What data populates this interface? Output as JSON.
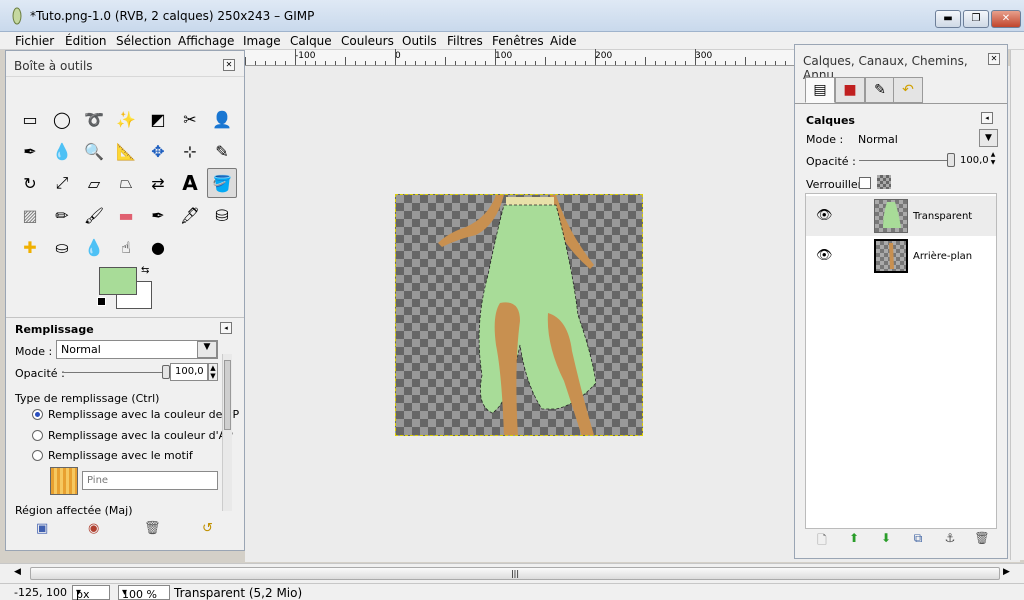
{
  "window": {
    "title": "*Tuto.png-1.0 (RVB, 2 calques) 250x243 – GIMP",
    "minimize": "▬",
    "maximize": "❐",
    "close": "✕"
  },
  "menu": [
    "Fichier",
    "Édition",
    "Sélection",
    "Affichage",
    "Image",
    "Calque",
    "Couleurs",
    "Outils",
    "Filtres",
    "Fenêtres",
    "Aide"
  ],
  "ruler": {
    "labels": [
      "-100",
      "0",
      "100",
      "200",
      "300"
    ]
  },
  "toolbox": {
    "title": "Boîte à outils",
    "fg_color": "#a8dc98",
    "bg_color": "#ffffff",
    "tools": [
      "rect-select-icon",
      "ellipse-select-icon",
      "lasso-icon",
      "magic-wand-icon",
      "select-by-color-icon",
      "scissors-icon",
      "foreground-select-icon",
      "paths-icon",
      "color-picker-icon",
      "zoom-icon",
      "measure-icon",
      "move-icon",
      "align-icon",
      "crop-icon",
      "rotate-icon",
      "scale-icon",
      "shear-icon",
      "perspective-icon",
      "flip-icon",
      "text-icon",
      "bucket-fill-icon",
      "blend-icon",
      "pencil-icon",
      "paintbrush-icon",
      "eraser-icon",
      "airbrush-icon",
      "ink-icon",
      "clone-icon",
      "heal-icon",
      "perspective-clone-icon",
      "blur-icon",
      "smudge-icon",
      "dodge-burn-icon"
    ]
  },
  "fill": {
    "title": "Remplissage",
    "mode_label": "Mode :",
    "mode_value": "Normal",
    "opacity_label": "Opacité :",
    "opacity_value": "100,0",
    "opacity_fraction": 1.0,
    "type_label": "Type de remplissage  (Ctrl)",
    "options": [
      "Remplissage avec la couleur de PP",
      "Remplissage avec la couleur d'AP",
      "Remplissage avec le motif"
    ],
    "selected_option": 0,
    "pattern_name": "Pine",
    "region_label": "Région affectée  (Maj)"
  },
  "layers": {
    "dock_title": "Calques, Canaux, Chemins, Annu...",
    "section_title": "Calques",
    "mode_label": "Mode :",
    "mode_value": "Normal",
    "opacity_label": "Opacité :",
    "opacity_value": "100,0",
    "opacity_fraction": 1.0,
    "lock_label": "Verrouiller :",
    "items": [
      {
        "name": "Transparent",
        "selected": true
      },
      {
        "name": "Arrière-plan",
        "selected": false
      }
    ]
  },
  "status": {
    "coords": "-125, 100",
    "unit": "px",
    "zoom": "100 %",
    "message": "Transparent (5,2 Mio)"
  },
  "colors": {
    "skirt": "#a8dc98",
    "skin": "#c89050",
    "selection": "#ddd000"
  }
}
